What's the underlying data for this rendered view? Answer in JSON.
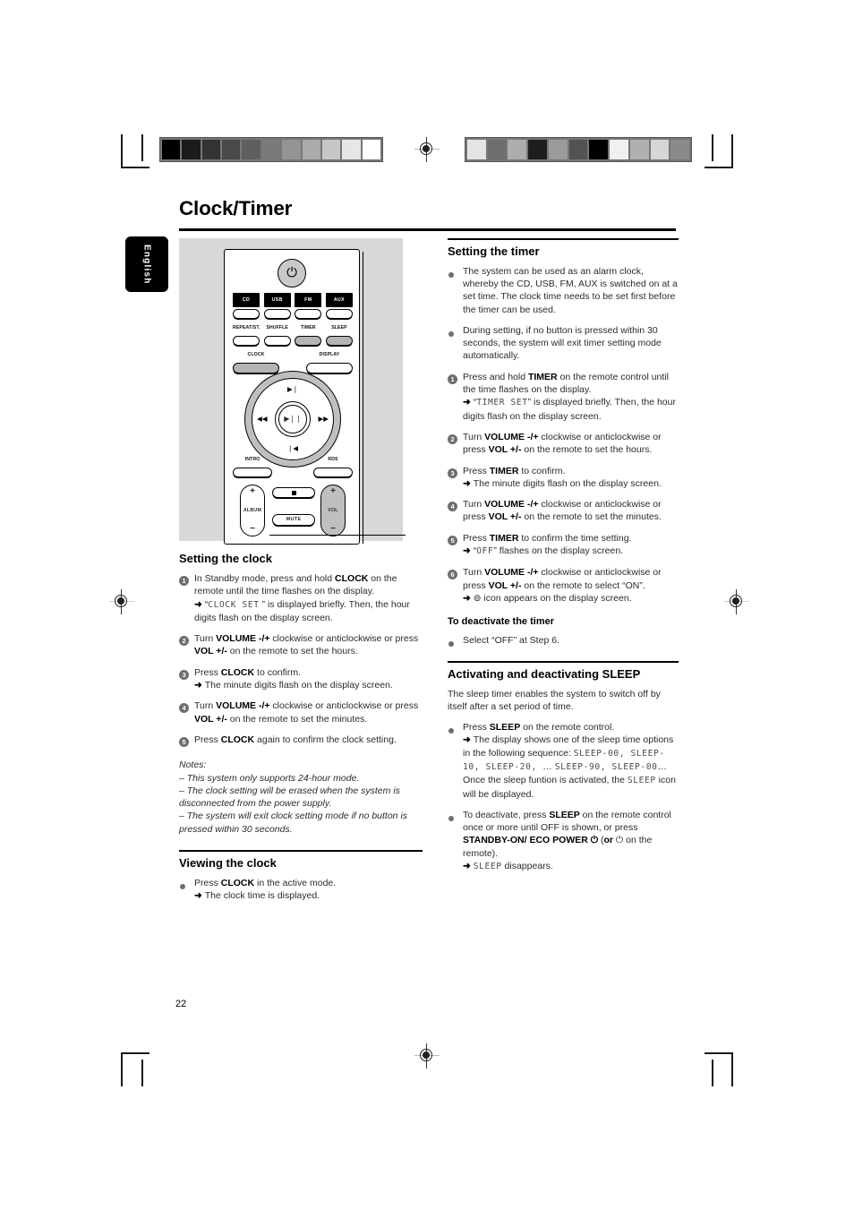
{
  "page": {
    "title": "Clock/Timer",
    "language_tab": "English",
    "page_number": "22"
  },
  "calibration": {
    "left_strip_colors": [
      "#000000",
      "#1c1c1c",
      "#333333",
      "#4a4a4a",
      "#5f5f5f",
      "#7a7a7a",
      "#949494",
      "#ababab",
      "#c6c6c6",
      "#e6e6e6",
      "#ffffff"
    ],
    "right_strip_colors": [
      "#e4e4e4",
      "#6e6e6e",
      "#adadad",
      "#1e1e1e",
      "#9a9a9a",
      "#525252",
      "#000000",
      "#f0f0f0",
      "#b0b0b0",
      "#d6d6d6",
      "#8a8a8a"
    ]
  },
  "remote": {
    "power_icon": "power-icon",
    "sources": [
      {
        "tag": "CD",
        "shaded": false
      },
      {
        "tag": "USB",
        "shaded": false
      },
      {
        "tag": "FM",
        "shaded": false
      },
      {
        "tag": "AUX",
        "shaded": false
      }
    ],
    "functions": [
      {
        "label": "REPEAT/ST.",
        "shaded": false
      },
      {
        "label": "SHUFFLE",
        "shaded": false
      },
      {
        "label": "TIMER",
        "shaded": true
      },
      {
        "label": "SLEEP",
        "shaded": true
      }
    ],
    "clock_label": "CLOCK",
    "display_label": "DISPLAY",
    "nav": {
      "up": "▶❘",
      "down": "❘◀",
      "left": "◀◀",
      "right": "▶▶",
      "center": "▶❘❘"
    },
    "intro_label": "INTRO",
    "rds_label": "RDS",
    "album_label": "ALBUM",
    "vol_label": "VOL",
    "plus": "+",
    "minus": "−",
    "mute_label": "MUTE"
  },
  "left_column": {
    "setting_clock": {
      "heading": "Setting the clock",
      "steps": [
        {
          "marker": "1",
          "lines": [
            {
              "type": "text",
              "segments": [
                {
                  "t": "In Standby mode, press and hold "
                },
                {
                  "t": "CLOCK",
                  "b": true
                },
                {
                  "t": " on the remote until the time flashes on the display."
                }
              ]
            },
            {
              "type": "arrow",
              "segments": [
                {
                  "t": "“"
                },
                {
                  "t": "CLOCK SET",
                  "lcd": true
                },
                {
                  "t": " ” is displayed briefly. Then, the hour digits flash on the display screen."
                }
              ]
            }
          ]
        },
        {
          "marker": "2",
          "lines": [
            {
              "type": "text",
              "segments": [
                {
                  "t": "Turn "
                },
                {
                  "t": "VOLUME -/+",
                  "b": true
                },
                {
                  "t": " clockwise or anticlockwise or press "
                },
                {
                  "t": "VOL +/-",
                  "b": true
                },
                {
                  "t": " on the remote to set the hours."
                }
              ]
            }
          ]
        },
        {
          "marker": "3",
          "lines": [
            {
              "type": "text",
              "segments": [
                {
                  "t": "Press "
                },
                {
                  "t": "CLOCK",
                  "b": true
                },
                {
                  "t": " to confirm."
                }
              ]
            },
            {
              "type": "arrow",
              "segments": [
                {
                  "t": "The minute digits flash on the display screen."
                }
              ]
            }
          ]
        },
        {
          "marker": "4",
          "lines": [
            {
              "type": "text",
              "segments": [
                {
                  "t": "Turn "
                },
                {
                  "t": "VOLUME -/+",
                  "b": true
                },
                {
                  "t": " clockwise or anticlockwise or press "
                },
                {
                  "t": "VOL +/-",
                  "b": true
                },
                {
                  "t": " on the remote to set the minutes."
                }
              ]
            }
          ]
        },
        {
          "marker": "5",
          "lines": [
            {
              "type": "text",
              "segments": [
                {
                  "t": "Press "
                },
                {
                  "t": "CLOCK",
                  "b": true
                },
                {
                  "t": " again to confirm the clock setting."
                }
              ]
            }
          ]
        }
      ],
      "notes_title": "Notes:",
      "notes": [
        "–  This system only supports 24-hour mode.",
        "–  The clock setting will be erased when the system is disconnected from the power supply.",
        "–  The system will exit clock setting mode if no button is pressed within 30 seconds."
      ]
    },
    "viewing_clock": {
      "heading": "Viewing the clock",
      "steps": [
        {
          "marker": "•",
          "lines": [
            {
              "type": "text",
              "segments": [
                {
                  "t": "Press "
                },
                {
                  "t": "CLOCK",
                  "b": true
                },
                {
                  "t": " in the active mode."
                }
              ]
            },
            {
              "type": "arrow",
              "segments": [
                {
                  "t": "The clock time is displayed."
                }
              ]
            }
          ]
        }
      ]
    }
  },
  "right_column": {
    "setting_timer": {
      "heading": "Setting the timer",
      "steps": [
        {
          "marker": "•",
          "lines": [
            {
              "type": "text",
              "segments": [
                {
                  "t": "The system can be used as an alarm clock, whereby the CD, USB, FM, AUX is switched on at a set time. The clock time needs to be set first before the timer can be used."
                }
              ]
            }
          ]
        },
        {
          "marker": "•",
          "lines": [
            {
              "type": "text",
              "segments": [
                {
                  "t": "During setting, if no button is pressed within 30 seconds, the system will exit timer setting mode automatically."
                }
              ]
            }
          ]
        },
        {
          "marker": "1",
          "lines": [
            {
              "type": "text",
              "segments": [
                {
                  "t": "Press and hold "
                },
                {
                  "t": "TIMER",
                  "b": true
                },
                {
                  "t": " on the remote control until the time flashes on the display."
                }
              ]
            },
            {
              "type": "arrow",
              "segments": [
                {
                  "t": "“"
                },
                {
                  "t": "TIMER SET",
                  "lcd": true
                },
                {
                  "t": "” is displayed briefly. Then, the hour digits flash on the display screen."
                }
              ]
            }
          ]
        },
        {
          "marker": "2",
          "lines": [
            {
              "type": "text",
              "segments": [
                {
                  "t": "Turn "
                },
                {
                  "t": "VOLUME -/+",
                  "b": true
                },
                {
                  "t": " clockwise or anticlockwise or press "
                },
                {
                  "t": "VOL +/-",
                  "b": true
                },
                {
                  "t": " on the remote to set the hours."
                }
              ]
            }
          ]
        },
        {
          "marker": "3",
          "lines": [
            {
              "type": "text",
              "segments": [
                {
                  "t": "Press "
                },
                {
                  "t": "TIMER",
                  "b": true
                },
                {
                  "t": " to confirm."
                }
              ]
            },
            {
              "type": "arrow",
              "segments": [
                {
                  "t": "The minute digits flash on the display screen."
                }
              ]
            }
          ]
        },
        {
          "marker": "4",
          "lines": [
            {
              "type": "text",
              "segments": [
                {
                  "t": "Turn "
                },
                {
                  "t": "VOLUME -/+",
                  "b": true
                },
                {
                  "t": " clockwise or anticlockwise or press "
                },
                {
                  "t": "VOL +/-",
                  "b": true
                },
                {
                  "t": " on the remote to set the minutes."
                }
              ]
            }
          ]
        },
        {
          "marker": "5",
          "lines": [
            {
              "type": "text",
              "segments": [
                {
                  "t": "Press "
                },
                {
                  "t": "TIMER",
                  "b": true
                },
                {
                  "t": " to confirm the time setting."
                }
              ]
            },
            {
              "type": "arrow",
              "segments": [
                {
                  "t": "“"
                },
                {
                  "t": "OFF",
                  "lcd": true
                },
                {
                  "t": "” flashes on the display screen."
                }
              ]
            }
          ]
        },
        {
          "marker": "6",
          "lines": [
            {
              "type": "text",
              "segments": [
                {
                  "t": " Turn "
                },
                {
                  "t": "VOLUME -/+",
                  "b": true
                },
                {
                  "t": " clockwise or anticlockwise or press "
                },
                {
                  "t": "VOL +/-",
                  "b": true
                },
                {
                  "t": " on the remote to select “ON”."
                }
              ]
            },
            {
              "type": "arrow",
              "segments": [
                {
                  "t": "⊚ icon appears on the display screen."
                }
              ]
            }
          ]
        }
      ],
      "deactivate_heading": "To  deactivate the timer",
      "deactivate_steps": [
        {
          "marker": "•",
          "lines": [
            {
              "type": "text",
              "segments": [
                {
                  "t": "Select “OFF” at Step 6."
                }
              ]
            }
          ]
        }
      ]
    },
    "sleep": {
      "heading": "Activating and deactivating SLEEP",
      "intro": "The sleep timer enables the system to switch off by itself after a set period of time.",
      "steps": [
        {
          "marker": "•",
          "lines": [
            {
              "type": "text",
              "segments": [
                {
                  "t": "Press "
                },
                {
                  "t": "SLEEP",
                  "b": true
                },
                {
                  "t": " on the remote control."
                }
              ]
            },
            {
              "type": "arrow",
              "segments": [
                {
                  "t": "The display shows one of the sleep time options in the following sequence: "
                },
                {
                  "t": "SLEEP-00, SLEEP-10, SLEEP-20, ",
                  "lcd": true
                },
                {
                  "t": "… "
                },
                {
                  "t": "SLEEP-90, SLEEP-00",
                  "lcd": true
                },
                {
                  "t": "…  Once the sleep funtion is activated, the "
                },
                {
                  "t": "SLEEP",
                  "lcd": true
                },
                {
                  "t": " icon will be displayed."
                }
              ]
            }
          ]
        },
        {
          "marker": "•",
          "lines": [
            {
              "type": "text",
              "segments": [
                {
                  "t": "To deactivate, press "
                },
                {
                  "t": "SLEEP",
                  "b": true
                },
                {
                  "t": " on the remote control once or more until OFF is shown, or press "
                },
                {
                  "t": "STANDBY-ON/ ECO POWER ⏻",
                  "b": true
                },
                {
                  "t": " ("
                },
                {
                  "t": "or",
                  "b": true
                },
                {
                  "t": " ⏻ on the remote)."
                }
              ]
            },
            {
              "type": "arrow",
              "segments": [
                {
                  "t": "",
                  "lcd": true
                },
                {
                  "t": "SLEEP",
                  "lcd": true
                },
                {
                  "t": " disappears."
                }
              ]
            }
          ]
        }
      ]
    }
  }
}
